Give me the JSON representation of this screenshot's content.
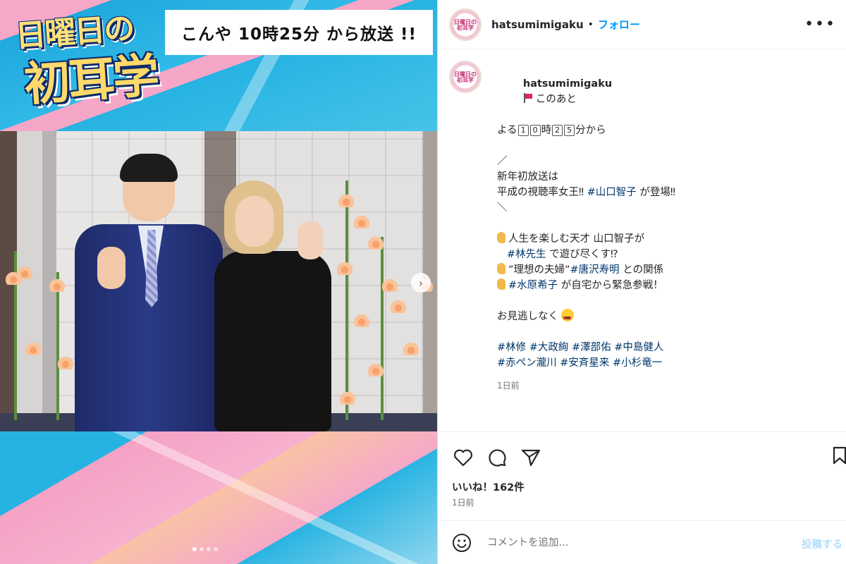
{
  "media": {
    "logo_line1": "日曜日の",
    "logo_line2": "初耳学",
    "broadcast_text": "こんや 10時25分 から放送 !!",
    "carousel_count": 4,
    "carousel_active": 1
  },
  "post": {
    "header": {
      "avatar_text": "日曜日の初耳学",
      "username": "hatsumimigaku",
      "separator": "•",
      "follow_label": "フォロー",
      "more_icon": "more-horizontal-icon"
    },
    "caption": {
      "username": "hatsumimigaku",
      "line1_text": "このあと",
      "line2_prefix": "よる",
      "line2_digits": [
        "1",
        "0",
        "2",
        "5"
      ],
      "line2_hour": "時",
      "line2_suffix": "分から",
      "slash_open": "／",
      "line3": "新年初放送は",
      "line4_prefix": "平成の視聴率女王‼ ",
      "line4_tag": "#山口智子",
      "line4_suffix": " が登場‼",
      "slash_close": "＼",
      "bullet1_text": "人生を楽しむ天才 山口智子が",
      "bullet1_tag": "#林先生",
      "bullet1_suffix": " で遊び尽くす⁉",
      "bullet2_prefix": "”理想の夫婦”",
      "bullet2_tag": "#唐沢寿明",
      "bullet2_suffix": " との関係",
      "bullet3_tag": "#水原希子",
      "bullet3_suffix": " が自宅から緊急参戦！",
      "closing": "お見逃しなく",
      "hashtags_line1": "#林修 #大政絢 #澤部佑 #中島健人",
      "hashtags_line2": "#赤ペン瀧川 #安斉星来 #小杉竜一",
      "time": "1日前"
    },
    "likes": "いいね！162件",
    "posted": "1日前",
    "comment": {
      "placeholder": "コメントを追加...",
      "post_label": "投稿する"
    }
  },
  "colors": {
    "accent": "#0095f6",
    "hashtag": "#00376b",
    "muted": "#737373",
    "post_button_disabled": "#b2dffc"
  }
}
